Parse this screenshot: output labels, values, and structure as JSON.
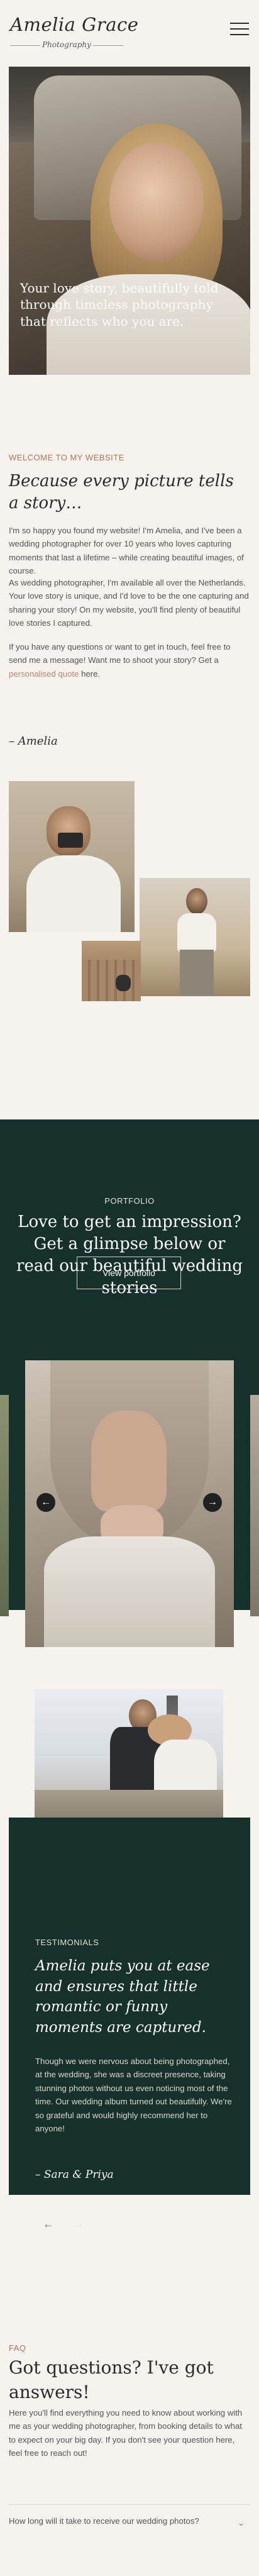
{
  "header": {
    "logo": "Amelia Grace",
    "logo_sub": "Photography"
  },
  "hero": {
    "tagline": "Your love story, beautifully told through timeless photography that reflects who you are."
  },
  "intro": {
    "kicker": "WELCOME TO MY WEBSITE",
    "title": "Because every picture tells a story…",
    "p1": "I'm so happy you found my website! I'm Amelia, and I've been a wedding photographer for over 10 years who loves capturing moments that last a lifetime – while creating beautiful images, of course.",
    "p2": "As wedding photographer, I'm available all over the Netherlands. Your love story is unique, and I'd love to be the one capturing and sharing your story! On my website, you'll find plenty of beautiful love stories I captured.",
    "p3_before": "If you have any questions or want to get in touch, feel free to send me a message! Want me to shoot your story? Get a ",
    "p3_link": "personalised quote",
    "p3_after": " here.",
    "signature": "– Amelia"
  },
  "portfolio": {
    "kicker": "PORTFOLIO",
    "title": "Love to get an impression? Get a glimpse below or read our beautiful wedding stories",
    "button": "View portfolio",
    "prev": "←",
    "next": "→"
  },
  "testimonials": {
    "kicker": "TESTIMONIALS",
    "quote": "Amelia puts you at ease and ensures that little romantic or funny moments are captured.",
    "body": "Though we were nervous about being photographed, at the wedding, she was a discreet presence, taking stunning photos without us even noticing most of the time. Our wedding album turned out beautifully. We're so grateful and would highly recommend her to anyone!",
    "author": "– Sara & Priya",
    "prev": "←",
    "next": "→"
  },
  "faq": {
    "kicker": "FAQ",
    "title": "Got questions? I've got answers!",
    "intro": "Here you'll find everything you need to know about working with me as your wedding photographer, from booking details to what to expect on your big day. If you don't see your question here, feel free to reach out!",
    "q1": "How long will it take to receive our wedding photos?",
    "chevron": "⌄"
  },
  "colors": {
    "accent": "#b7725a",
    "dark_green": "#16302b",
    "background": "#f6f3ef"
  }
}
